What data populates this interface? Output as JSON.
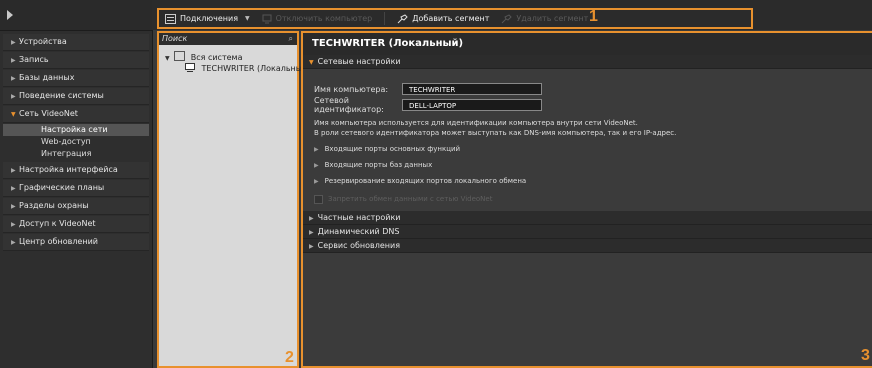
{
  "toolbar": {
    "connections": "Подключения",
    "disconnect": "Отключить компьютер",
    "add_segment": "Добавить сегмент",
    "remove_segment": "Удалить сегмент",
    "label_1": "1"
  },
  "nav": {
    "items": [
      {
        "label": "Устройства"
      },
      {
        "label": "Запись"
      },
      {
        "label": "Базы данных"
      },
      {
        "label": "Поведение системы"
      },
      {
        "label": "Сеть VideoNet"
      },
      {
        "label": "Настройка интерфейса"
      },
      {
        "label": "Графические планы"
      },
      {
        "label": "Разделы охраны"
      },
      {
        "label": "Доступ к VideoNet"
      },
      {
        "label": "Центр обновлений"
      }
    ],
    "sub": [
      "Настройка сети",
      "Web-доступ",
      "Интеграция"
    ]
  },
  "tree": {
    "search_placeholder": "Поиск",
    "root": "Вся система",
    "node": "TECHWRITER (Локальный)",
    "label_2": "2"
  },
  "main": {
    "title": "TECHWRITER (Локальный)",
    "net_settings": "Сетевые настройки",
    "computer_name_label": "Имя компьютера:",
    "computer_name_value": "TECHWRITER",
    "net_id_label": "Сетевой идентификатор:",
    "net_id_value": "DELL-LAPTOP",
    "info_line1": "Имя компьютера используется для идентификации компьютера внутри сети VideoNet.",
    "info_line2": "В роли сетевого идентификатора может выступать как DNS-имя компьютера, так и его IP-адрес.",
    "incoming_main": "Входящие порты основных функций",
    "incoming_db": "Входящие порты баз данных",
    "reserve_ports": "Резервирование входящих портов локального обмена",
    "forbid_exchange": "Запретить обмен данными с сетью VideoNet",
    "private_settings": "Частные настройки",
    "dynamic_dns": "Динамический DNS",
    "update_service": "Сервис обновления",
    "label_3": "3"
  },
  "colors": {
    "accent": "#e8912e"
  }
}
